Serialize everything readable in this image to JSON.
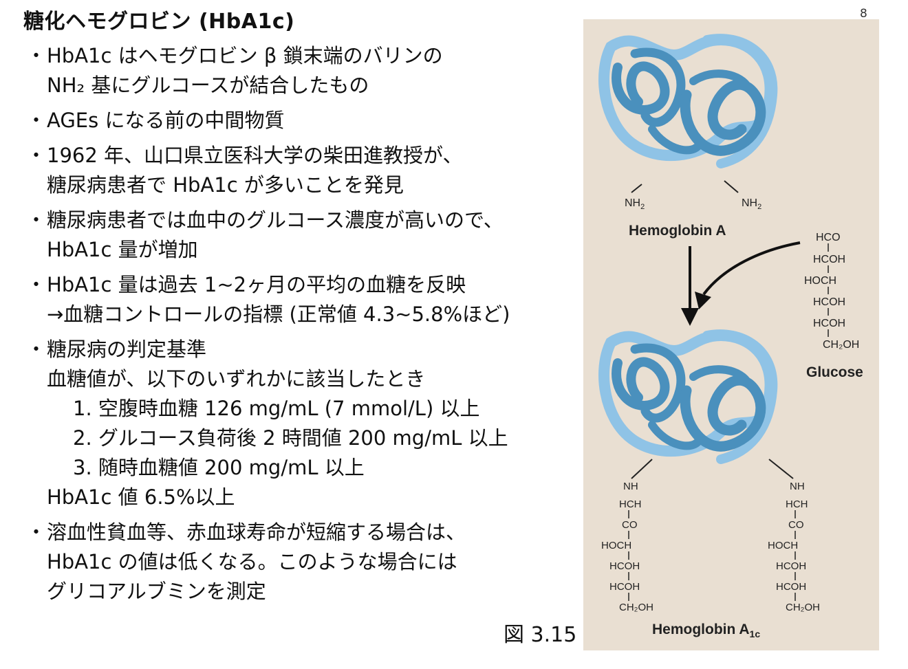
{
  "slide": {
    "title": "糖化ヘモグロビン (HbA1c)",
    "page_number": "8",
    "bullet_marker": "・",
    "bullets": [
      {
        "lines": [
          "HbA1c はヘモグロビン β 鎖末端のバリンの",
          "NH₂ 基にグルコースが結合したもの"
        ]
      },
      {
        "lines": [
          "AGEs になる前の中間物質"
        ]
      },
      {
        "lines": [
          "1962 年、山口県立医科大学の柴田進教授が、",
          "糖尿病患者で HbA1c が多いことを発見"
        ]
      },
      {
        "lines": [
          "糖尿病患者では血中のグルコース濃度が高いので、",
          "HbA1c 量が増加"
        ]
      },
      {
        "lines": [
          "HbA1c 量は過去 1~2ヶ月の平均の血糖を反映",
          "→血糖コントロールの指標 (正常値 4.3~5.8%ほど)"
        ]
      },
      {
        "lines": [
          "糖尿病の判定基準",
          "血糖値が、以下のいずれかに該当したとき"
        ],
        "sub": [
          "1. 空腹時血糖 126 mg/mL (7 mmol/L) 以上",
          "2. グルコース負荷後 2 時間値 200 mg/mL 以上",
          "3. 随時血糖値 200 mg/mL 以上"
        ],
        "tail": "HbA1c 値 6.5%以上"
      },
      {
        "lines": [
          "溶血性貧血等、赤血球寿命が短縮する場合は、",
          "HbA1c の値は低くなる。このような場合には",
          "グリコアルブミンを測定"
        ]
      }
    ],
    "caption": "図 3.15"
  },
  "figure": {
    "hemoglobin_a_label": "Hemoglobin A",
    "hemoglobin_a1c_label": "Hemoglobin A",
    "hemoglobin_a1c_sub": "1c",
    "nh2_left": "NH",
    "nh2_right": "NH",
    "nh2_sub": "2",
    "glucose_label": "Glucose",
    "glucose_chain": [
      "HCO",
      "HCOH",
      "HOCH",
      "HCOH",
      "HCOH",
      "CH₂OH"
    ],
    "side_chain": [
      "NH",
      "HCH",
      "CO",
      "HOCH",
      "HCOH",
      "HCOH",
      "CH₂OH"
    ],
    "colors": {
      "background": "#e9dfd2",
      "protein_dark": "#4a90bd",
      "protein_light": "#8fc3e6"
    }
  }
}
